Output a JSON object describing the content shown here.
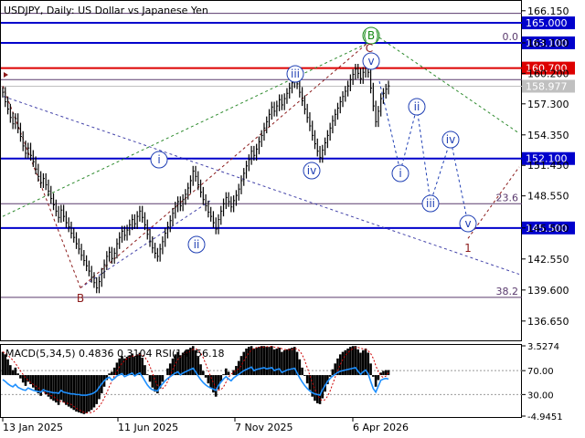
{
  "chart_data": {
    "type": "line",
    "title": "USDJPY, Daily:  US Dollar vs Japanese Yen",
    "symbol": "USDJPY",
    "timeframe": "Daily",
    "description": "US Dollar vs Japanese Yen",
    "xlabels": [
      "13 Jan 2025",
      "11 Jun 2025",
      "7 Nov 2025",
      "6 Apr 2026"
    ],
    "y_ticks": [
      "166.150",
      "163.100",
      "160.200",
      "157.300",
      "154.350",
      "151.450",
      "148.550",
      "145.500",
      "142.550",
      "139.600",
      "136.650"
    ],
    "ylim": [
      134.9,
      167.0
    ],
    "current_price": "158.977",
    "levels": [
      {
        "value": 165.0,
        "label": "165.000",
        "color": "#0000cc"
      },
      {
        "value": 163.1,
        "label": "163.100",
        "color": "#0000cc"
      },
      {
        "value": 160.7,
        "label": "160.700",
        "color": "#dd0000"
      },
      {
        "value": 152.1,
        "label": "152.100",
        "color": "#0000cc"
      },
      {
        "value": 145.5,
        "label": "145.500",
        "color": "#0000cc"
      }
    ],
    "fib_labels": [
      {
        "label": "0.0",
        "value": 163.1
      },
      {
        "label": "23.6",
        "value": 147.8
      },
      {
        "label": "38.2",
        "value": 138.9
      }
    ],
    "series": [
      {
        "values": [
          158.4,
          157.5,
          156.8,
          156.0,
          155.4,
          155.9,
          155.0,
          154.2,
          153.3,
          152.6,
          153.1,
          152.4,
          151.8,
          151.1,
          150.4,
          149.8,
          150.2,
          149.6,
          149.0,
          148.3,
          147.7,
          147.1,
          146.5,
          147.2,
          146.6,
          146.0,
          145.6,
          145.0,
          144.6,
          144.0,
          143.5,
          142.9,
          142.4,
          141.9,
          141.4,
          140.8,
          140.3,
          139.8,
          140.4,
          141.2,
          142.0,
          142.8,
          143.2,
          142.6,
          143.1,
          144.0,
          144.6,
          145.2,
          144.8,
          145.3,
          145.8,
          146.3,
          145.9,
          146.6,
          147.1,
          146.5,
          145.8,
          144.9,
          144.2,
          143.6,
          143.1,
          142.8,
          143.5,
          144.2,
          145.0,
          145.6,
          146.2,
          146.9,
          147.5,
          148.0,
          147.6,
          148.2,
          148.7,
          149.3,
          150.0,
          150.9,
          150.4,
          149.6,
          148.9,
          148.2,
          147.6,
          147.0,
          146.6,
          146.0,
          145.4,
          146.3,
          147.1,
          147.8,
          148.4,
          148.0,
          147.5,
          148.1,
          148.6,
          149.2,
          150.0,
          150.7,
          151.4,
          152.0,
          152.8,
          152.4,
          153.0,
          153.7,
          154.3,
          155.0,
          155.6,
          156.3,
          157.0,
          156.6,
          157.1,
          157.7,
          157.2,
          157.8,
          158.3,
          158.8,
          159.3,
          159.8,
          159.2,
          158.4,
          157.6,
          156.8,
          156.0,
          155.2,
          154.3,
          153.5,
          152.8,
          152.2,
          152.9,
          153.6,
          154.3,
          155.0,
          155.7,
          156.3,
          156.9,
          157.5,
          158.0,
          158.5,
          159.0,
          159.6,
          160.1,
          160.6,
          160.2,
          159.7,
          160.3,
          160.8,
          160.3,
          158.8,
          157.1,
          155.6,
          156.6,
          157.8,
          158.3,
          158.7,
          159.0
        ]
      }
    ],
    "wave_labels": [
      {
        "text": "B",
        "color": "#8b1a1a",
        "shape": "plain"
      },
      {
        "text": "(B)",
        "color": "#1a8b1a",
        "shape": "circle"
      },
      {
        "text": "C",
        "color": "#8b1a1a",
        "shape": "plain"
      },
      {
        "text": "i",
        "color": "#1f3fb4",
        "shape": "circle"
      },
      {
        "text": "ii",
        "color": "#1f3fb4",
        "shape": "circle"
      },
      {
        "text": "iii",
        "color": "#1f3fb4",
        "shape": "circle"
      },
      {
        "text": "iv",
        "color": "#1f3fb4",
        "shape": "circle"
      },
      {
        "text": "v",
        "color": "#1f3fb4",
        "shape": "circle"
      },
      {
        "text": "1",
        "color": "#8b1a1a",
        "shape": "plain"
      }
    ]
  },
  "indicator": {
    "label": "MACD(5,34,5) 0.4836 0.3104 RSI(14) 56.18",
    "y_ticks": [
      "3.5274",
      "70.00",
      "30.00",
      "-4.9451"
    ],
    "macd_values": [
      2.8,
      2.5,
      1.9,
      1.2,
      0.6,
      0.9,
      0.2,
      -0.4,
      -0.9,
      -1.3,
      -0.8,
      -1.1,
      -1.5,
      -1.9,
      -2.2,
      -2.5,
      -2.0,
      -2.3,
      -2.6,
      -2.9,
      -3.1,
      -3.3,
      -3.6,
      -3.0,
      -3.3,
      -3.6,
      -3.8,
      -4.0,
      -4.2,
      -4.4,
      -4.5,
      -4.6,
      -4.7,
      -4.6,
      -4.4,
      -4.2,
      -3.9,
      -3.5,
      -2.9,
      -2.2,
      -1.4,
      -0.6,
      0.2,
      0.4,
      0.9,
      1.5,
      2.0,
      2.3,
      2.0,
      2.2,
      2.4,
      2.6,
      2.2,
      2.5,
      2.7,
      2.1,
      1.2,
      0.1,
      -0.8,
      -1.5,
      -2.0,
      -2.2,
      -1.6,
      -0.8,
      0.0,
      0.8,
      1.4,
      2.0,
      2.5,
      2.8,
      2.4,
      2.7,
      2.9,
      3.1,
      3.3,
      3.5,
      3.0,
      2.2,
      1.3,
      0.5,
      -0.3,
      -1.0,
      -1.6,
      -2.1,
      -2.6,
      -1.7,
      -0.8,
      0.1,
      0.8,
      0.4,
      0.0,
      0.6,
      1.1,
      1.7,
      2.3,
      2.8,
      3.2,
      3.4,
      3.5,
      3.2,
      3.3,
      3.4,
      3.5,
      3.5,
      3.4,
      3.4,
      3.5,
      3.1,
      3.2,
      3.3,
      2.8,
      3.0,
      3.1,
      3.2,
      3.3,
      3.4,
      2.8,
      1.9,
      0.9,
      -0.1,
      -1.0,
      -1.8,
      -2.6,
      -3.1,
      -3.4,
      -3.5,
      -2.8,
      -2.0,
      -1.1,
      -0.2,
      0.7,
      1.4,
      2.0,
      2.5,
      2.8,
      3.0,
      3.2,
      3.4,
      3.5,
      3.5,
      3.1,
      2.7,
      3.0,
      3.2,
      2.7,
      1.4,
      -0.2,
      -1.4,
      -0.6,
      0.3,
      0.5,
      0.6,
      0.6
    ],
    "rsi_values": [
      55,
      52,
      48,
      45,
      43,
      47,
      42,
      40,
      38,
      37,
      41,
      39,
      37,
      36,
      35,
      34,
      38,
      36,
      35,
      34,
      33,
      33,
      32,
      37,
      34,
      33,
      32,
      31,
      31,
      30,
      30,
      29,
      29,
      29,
      30,
      31,
      33,
      36,
      42,
      48,
      53,
      57,
      59,
      54,
      57,
      61,
      63,
      65,
      60,
      62,
      64,
      66,
      61,
      64,
      66,
      60,
      53,
      46,
      41,
      38,
      37,
      36,
      43,
      48,
      53,
      57,
      60,
      63,
      66,
      68,
      63,
      66,
      68,
      70,
      72,
      74,
      68,
      61,
      55,
      50,
      46,
      43,
      41,
      39,
      37,
      45,
      51,
      56,
      60,
      56,
      53,
      58,
      61,
      64,
      67,
      70,
      72,
      74,
      76,
      70,
      72,
      73,
      74,
      75,
      73,
      74,
      75,
      70,
      72,
      73,
      67,
      69,
      71,
      72,
      73,
      74,
      66,
      58,
      51,
      45,
      40,
      36,
      33,
      31,
      30,
      29,
      38,
      45,
      52,
      57,
      61,
      64,
      67,
      69,
      70,
      71,
      72,
      73,
      74,
      75,
      69,
      64,
      68,
      71,
      65,
      52,
      40,
      34,
      44,
      54,
      56,
      57,
      56
    ]
  }
}
